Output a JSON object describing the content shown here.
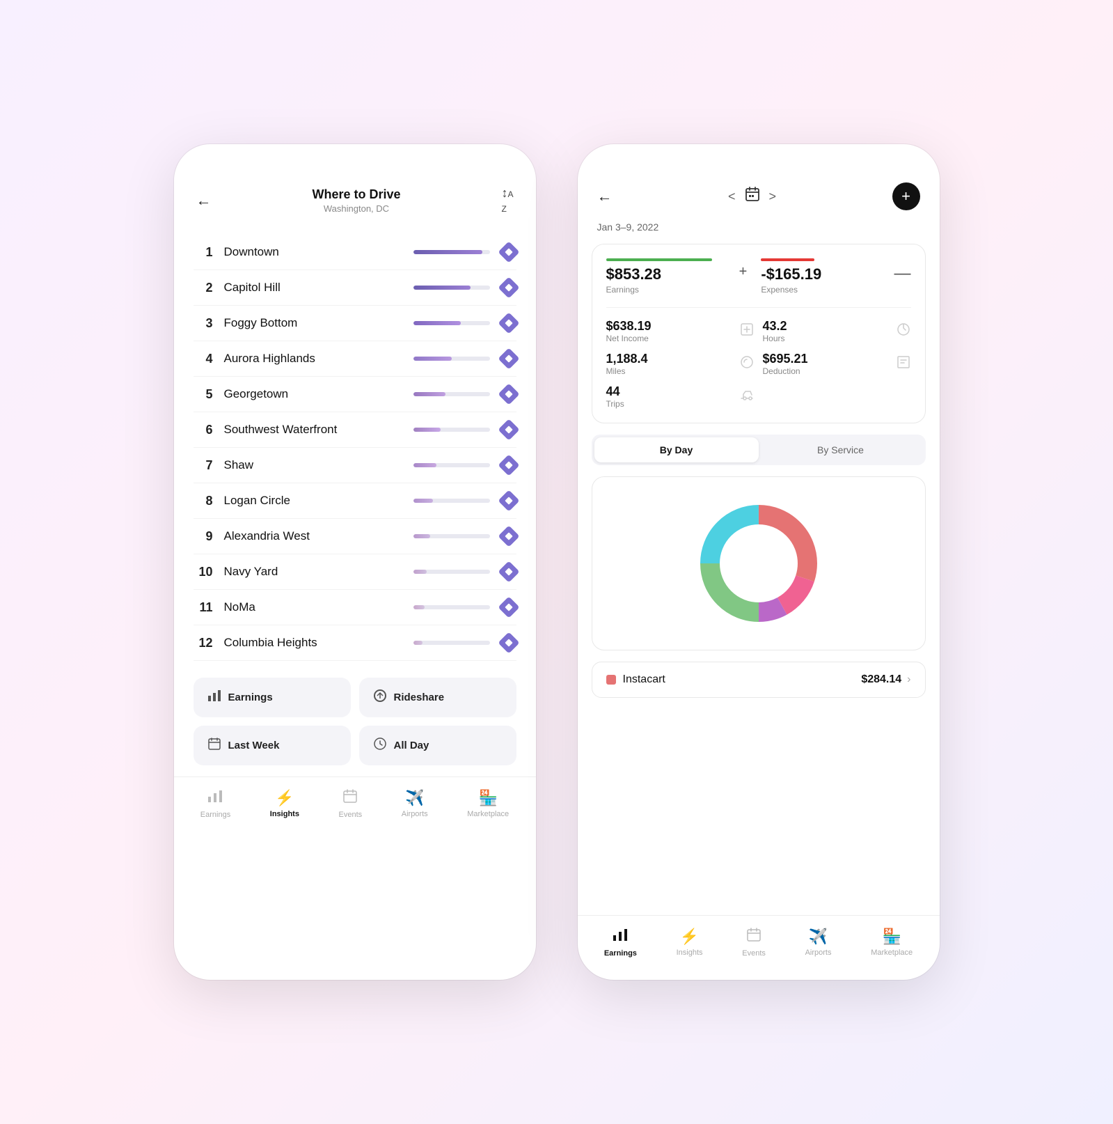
{
  "left_phone": {
    "header": {
      "title": "Where to Drive",
      "subtitle": "Washington, DC",
      "back_label": "←",
      "sort_label": "↕ A↓Z"
    },
    "locations": [
      {
        "rank": "1",
        "name": "Downtown",
        "bar_class": "bar-1"
      },
      {
        "rank": "2",
        "name": "Capitol Hill",
        "bar_class": "bar-2"
      },
      {
        "rank": "3",
        "name": "Foggy Bottom",
        "bar_class": "bar-3"
      },
      {
        "rank": "4",
        "name": "Aurora Highlands",
        "bar_class": "bar-4"
      },
      {
        "rank": "5",
        "name": "Georgetown",
        "bar_class": "bar-5"
      },
      {
        "rank": "6",
        "name": "Southwest Waterfront",
        "bar_class": "bar-6"
      },
      {
        "rank": "7",
        "name": "Shaw",
        "bar_class": "bar-7"
      },
      {
        "rank": "8",
        "name": "Logan Circle",
        "bar_class": "bar-8"
      },
      {
        "rank": "9",
        "name": "Alexandria West",
        "bar_class": "bar-9"
      },
      {
        "rank": "10",
        "name": "Navy Yard",
        "bar_class": "bar-10"
      },
      {
        "rank": "11",
        "name": "NoMa",
        "bar_class": "bar-11"
      },
      {
        "rank": "12",
        "name": "Columbia Heights",
        "bar_class": "bar-12"
      }
    ],
    "filters": [
      {
        "label": "Earnings",
        "icon": "📊"
      },
      {
        "label": "Rideshare",
        "icon": "🔄"
      },
      {
        "label": "Last Week",
        "icon": "📅"
      },
      {
        "label": "All Day",
        "icon": "🕐"
      }
    ],
    "bottom_nav": [
      {
        "label": "Earnings",
        "icon": "📊",
        "active": false
      },
      {
        "label": "Insights",
        "icon": "⚡",
        "active": true
      },
      {
        "label": "Events",
        "icon": "📅",
        "active": false
      },
      {
        "label": "Airports",
        "icon": "✈️",
        "active": false
      },
      {
        "label": "Marketplace",
        "icon": "🏪",
        "active": false
      }
    ]
  },
  "right_phone": {
    "header": {
      "back_label": "←",
      "date_range": "Jan 3–9, 2022",
      "add_label": "+"
    },
    "stats": {
      "earnings": {
        "value": "$853.28",
        "label": "Earnings"
      },
      "expenses": {
        "value": "-$165.19",
        "label": "Expenses"
      },
      "net_income": {
        "value": "$638.19",
        "label": "Net Income"
      },
      "hours": {
        "value": "43.2",
        "label": "Hours"
      },
      "miles": {
        "value": "1,188.4",
        "label": "Miles"
      },
      "deduction": {
        "value": "$695.21",
        "label": "Deduction"
      },
      "trips": {
        "value": "44",
        "label": "Trips"
      }
    },
    "tabs": [
      {
        "label": "By Day",
        "active": true
      },
      {
        "label": "By Service",
        "active": false
      }
    ],
    "chart": {
      "segments": [
        {
          "color": "#e57373",
          "percent": 30,
          "start": 0
        },
        {
          "color": "#f06292",
          "percent": 12,
          "start": 30
        },
        {
          "color": "#ba68c8",
          "percent": 8,
          "start": 42
        },
        {
          "color": "#81c784",
          "percent": 25,
          "start": 50
        },
        {
          "color": "#4dd0e1",
          "percent": 25,
          "start": 75
        }
      ]
    },
    "service": {
      "name": "Instacart",
      "amount": "$284.14",
      "color": "#e57373"
    },
    "bottom_nav": [
      {
        "label": "Earnings",
        "icon": "📊",
        "active": true
      },
      {
        "label": "Insights",
        "icon": "⚡",
        "active": false
      },
      {
        "label": "Events",
        "icon": "📅",
        "active": false
      },
      {
        "label": "Airports",
        "icon": "✈️",
        "active": false
      },
      {
        "label": "Marketplace",
        "icon": "🏪",
        "active": false
      }
    ]
  }
}
